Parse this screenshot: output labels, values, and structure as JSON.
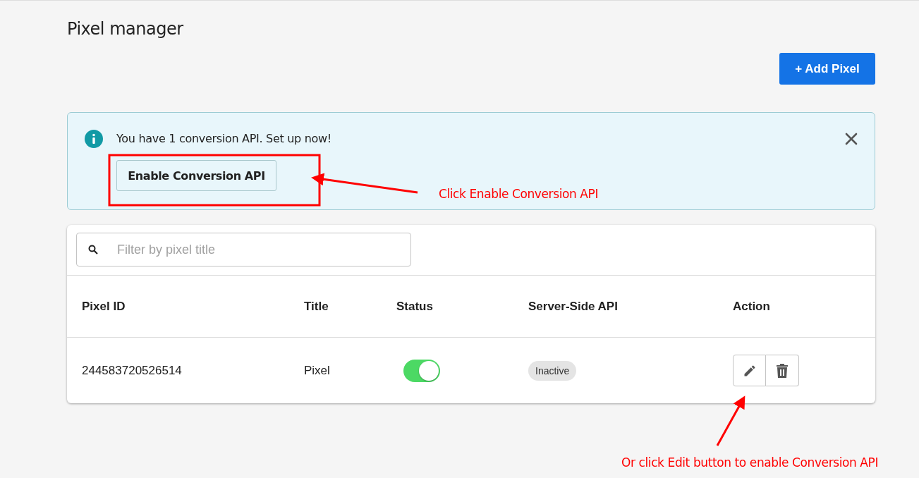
{
  "page": {
    "title": "Pixel manager"
  },
  "add_button": {
    "label": "+ Add Pixel"
  },
  "banner": {
    "message": "You have 1 conversion API. Set up now!",
    "button": "Enable Conversion API"
  },
  "search": {
    "placeholder": "Filter by pixel title"
  },
  "table": {
    "columns": [
      "Pixel ID",
      "Title",
      "Status",
      "Server-Side API",
      "Action"
    ],
    "rows": [
      {
        "pixel_id": "244583720526514",
        "title": "Pixel",
        "on": true,
        "server_side_api": "Inactive"
      }
    ]
  },
  "annotations": [
    {
      "text": "Click Enable Conversion API"
    },
    {
      "text": "Or click Edit button to enable Conversion API"
    }
  ]
}
